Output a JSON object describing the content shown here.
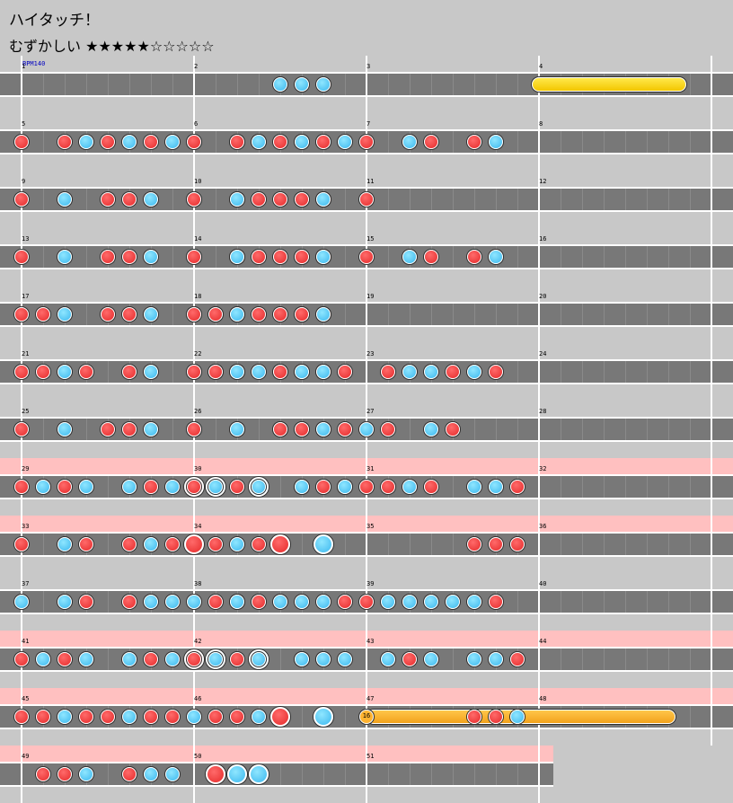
{
  "song": {
    "title": "ハイタッチ！",
    "difficulty": "むずかしい",
    "stars": "★★★★★☆☆☆☆☆",
    "bpm_label": "BPM140"
  },
  "chart": {
    "measures_per_row": 4,
    "subdivisions": 16,
    "rows": [
      {
        "start": 1,
        "gogo": false,
        "measures": [
          "0000000000000000",
          "0000000000000000",
          "000000000000KKK0",
          "Y0000000000000000"
        ]
      },
      {
        "start": 5,
        "gogo": false,
        "measures": [
          "D0DKDKDKDKDDKDKD",
          "0000000000000000",
          "D0DKDKDKDKDDKDKD",
          "0000000000000000"
        ]
      },
      {
        "start": 9,
        "gogo": false,
        "measures": [
          "D0K0DDK0D0KD0DDK",
          "0000000000000000",
          "D0K0DDK0D0KD0DDK",
          "0000000000000000"
        ]
      },
      {
        "start": 13,
        "gogo": false,
        "measures": [
          "D0K0DDK0D0KD0DDK",
          "0000000000000000",
          "D0K0DDK0D0KD0DDK",
          "0000000000000000"
        ]
      },
      {
        "start": 17,
        "gogo": false,
        "measures": [
          "DDK0DDK0DDK0DDK0",
          "0000000000000000",
          "DDK0DDK0DDK0DDK0",
          "0000000000000000"
        ]
      },
      {
        "start": 21,
        "gogo": false,
        "measures": [
          "DDKD0DK0DDK0DDKD",
          "0000000000000000",
          "DDKD0DK0DDK0DDKD",
          "0000000000000000"
        ]
      },
      {
        "start": 25,
        "gogo": false,
        "measures": [
          "D0K0DDK0D0KD0DDK",
          "0000000000000000",
          "D0K0DDK0D0KD0DDK",
          "0000000000000000"
        ]
      },
      {
        "start": 29,
        "gogo": true,
        "measures": [
          "DKDK0DKBK0B0DKDK",
          "0000000000000000",
          "DKDK0DKBK0B0DKDK",
          "0000000000000000"
        ]
      },
      {
        "start": 33,
        "gogo": true,
        "measures": [
          "D0KD0DKD0DKDB0B0",
          "0000000000000000",
          "D0KD0DKD0DKDB0B0",
          "0000000000000000"
        ]
      },
      {
        "start": 37,
        "gogo": false,
        "measures": [
          "K0DK0DKK0KDK0DKK",
          "0000000000000000",
          "K0DK0DKK0KDK0DKK",
          "0000000000000000"
        ]
      },
      {
        "start": 41,
        "gogo": true,
        "measures": [
          "DKDK0DKBK0B0DKDK",
          "0000000000000000",
          "DKDK0DKBK0B0DKDK",
          "0000000000000000"
        ]
      },
      {
        "start": 45,
        "gogo": true,
        "measures": [
          "DDKDDKDDKDDKB0B0",
          "0000000000000000",
          "DDKDDKDDKDDKB0B0",
          "0000000000000000"
        ]
      },
      {
        "start": 49,
        "gogo": true,
        "measures": [
          "0DDK0DKK0B0BB000",
          "0000000000000000",
          "0000000000000000"
        ]
      }
    ],
    "balloon": {
      "measure": 47,
      "count": "16"
    }
  },
  "colors": {
    "don": "#e52a2a",
    "ka": "#3cb8ee",
    "roll_yellow": "#f3c600",
    "roll_orange": "#f2a21c",
    "gogo": "#ffc0c0",
    "lane": "#787878",
    "background": "#c8c8c8"
  }
}
